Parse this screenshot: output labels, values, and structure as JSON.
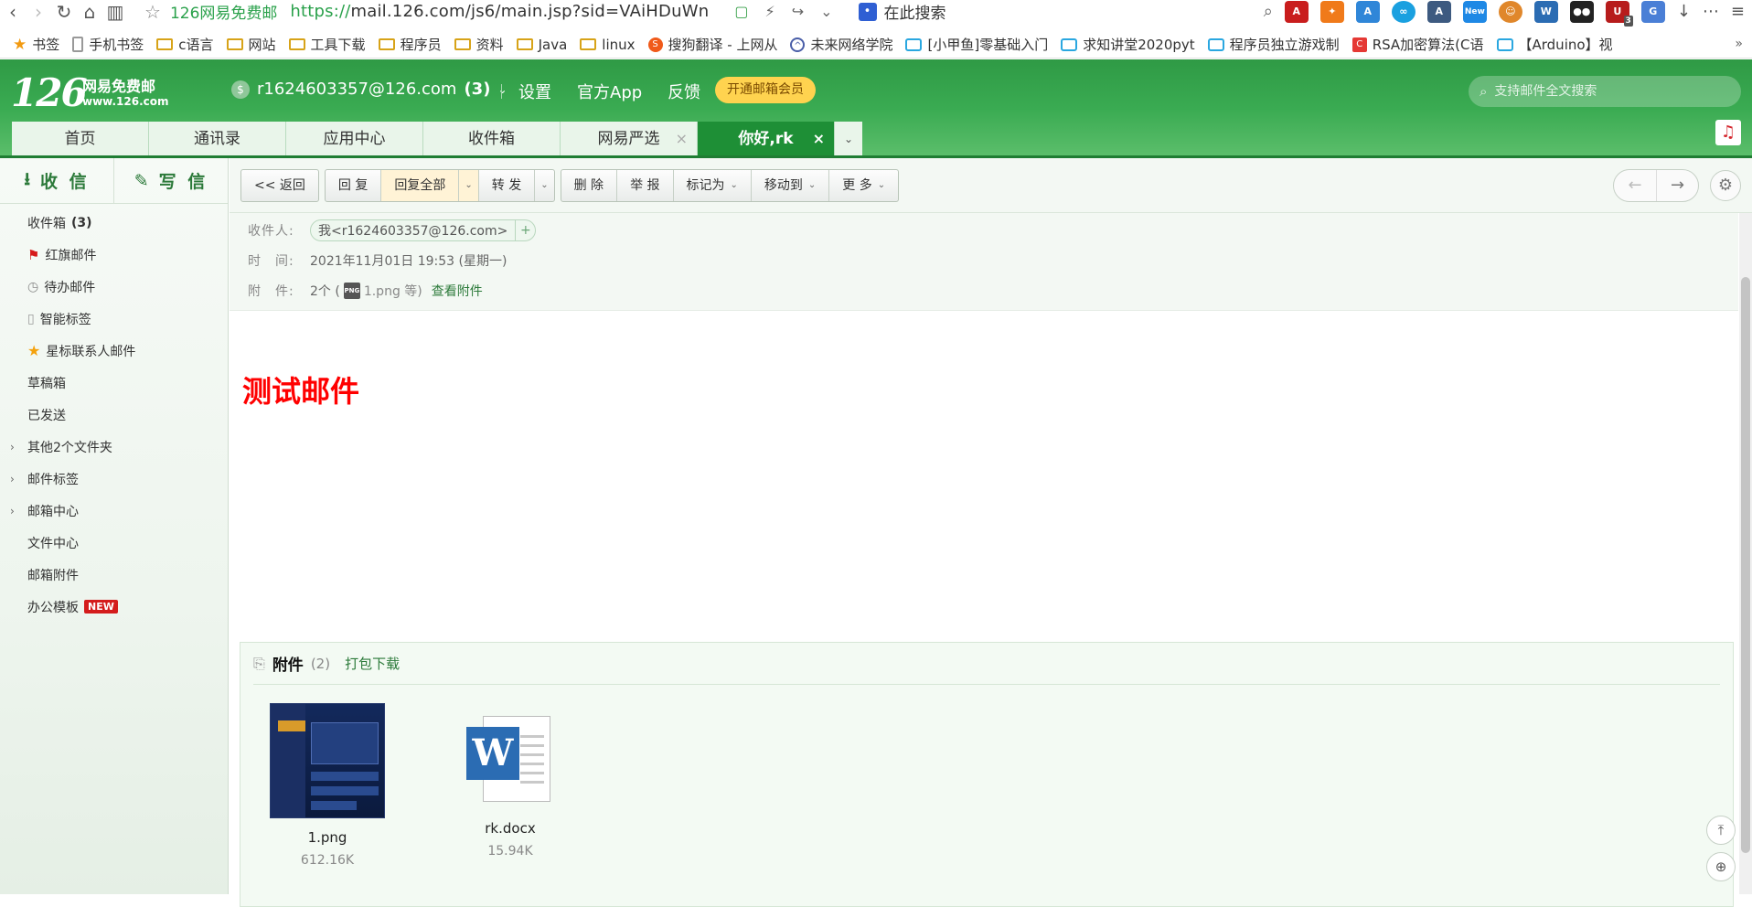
{
  "browser": {
    "page_title": "126网易免费邮",
    "url_scheme": "https://",
    "url_host": "mail.126.com",
    "url_rest": "/js6/main.jsp?sid=VAiHDuWn",
    "search_placeholder": "在此搜索",
    "bookmarks": [
      {
        "label": "书签",
        "icon": "star-icon"
      },
      {
        "label": "手机书签",
        "icon": "phone-icon"
      },
      {
        "label": "c语言",
        "icon": "folder-icon"
      },
      {
        "label": "网站",
        "icon": "folder-icon"
      },
      {
        "label": "工具下载",
        "icon": "folder-icon"
      },
      {
        "label": "程序员",
        "icon": "folder-icon"
      },
      {
        "label": "资料",
        "icon": "folder-icon"
      },
      {
        "label": "Java",
        "icon": "folder-icon"
      },
      {
        "label": "linux",
        "icon": "folder-icon"
      },
      {
        "label": "搜狗翻译 - 上网从",
        "icon": "sogou-icon"
      },
      {
        "label": "未来网络学院",
        "icon": "site-icon"
      },
      {
        "label": "[小甲鱼]零基础入门",
        "icon": "bilibili-icon"
      },
      {
        "label": "求知讲堂2020pyt",
        "icon": "bilibili-icon"
      },
      {
        "label": "程序员独立游戏制",
        "icon": "bilibili-icon"
      },
      {
        "label": "RSA加密算法(C语",
        "icon": "csdn-icon"
      },
      {
        "label": "【Arduino】视",
        "icon": "bilibili-icon"
      }
    ],
    "ext_badge": "3",
    "ext_new": "New"
  },
  "mail": {
    "logo_num": "126",
    "logo_name": "网易免费邮",
    "logo_site": "www.126.com",
    "account": "r1624603357@126.com",
    "account_count": "(3)",
    "links": [
      "设置",
      "官方App",
      "反馈"
    ],
    "vip_button": "开通邮箱会员",
    "search_placeholder": "支持邮件全文搜索",
    "tabs": [
      "首页",
      "通讯录",
      "应用中心",
      "收件箱",
      "网易严选",
      "你好,rk"
    ],
    "compose": {
      "receive": "收 信",
      "write": "写 信"
    },
    "folders": [
      {
        "label": "收件箱",
        "count": "(3)"
      },
      {
        "label": "红旗邮件"
      },
      {
        "label": "待办邮件"
      },
      {
        "label": "智能标签"
      },
      {
        "label": "星标联系人邮件"
      },
      {
        "label": "草稿箱"
      },
      {
        "label": "已发送"
      },
      {
        "label": "其他2个文件夹"
      },
      {
        "label": "邮件标签"
      },
      {
        "label": "邮箱中心"
      },
      {
        "label": "文件中心"
      },
      {
        "label": "邮箱附件"
      },
      {
        "label": "办公模板",
        "badge": "NEW"
      }
    ],
    "toolbar": {
      "back": "<< 返回",
      "reply": "回 复",
      "reply_all": "回复全部",
      "forward": "转 发",
      "delete": "删 除",
      "report": "举 报",
      "mark_as": "标记为",
      "move_to": "移动到",
      "more": "更 多"
    },
    "message": {
      "to_label": "收件人:",
      "to_value": "我<r1624603357@126.com>",
      "time_label": "时　间:",
      "time_value": "2021年11月01日 19:53 (星期一)",
      "att_label": "附　件:",
      "att_count": "2个 (",
      "att_first": "1.png 等)",
      "att_view": "查看附件",
      "body": "测试邮件"
    },
    "attachments": {
      "title": "附件",
      "count": "(2)",
      "download_all": "打包下载",
      "files": [
        {
          "name": "1.png",
          "size": "612.16K"
        },
        {
          "name": "rk.docx",
          "size": "15.94K"
        }
      ]
    }
  }
}
